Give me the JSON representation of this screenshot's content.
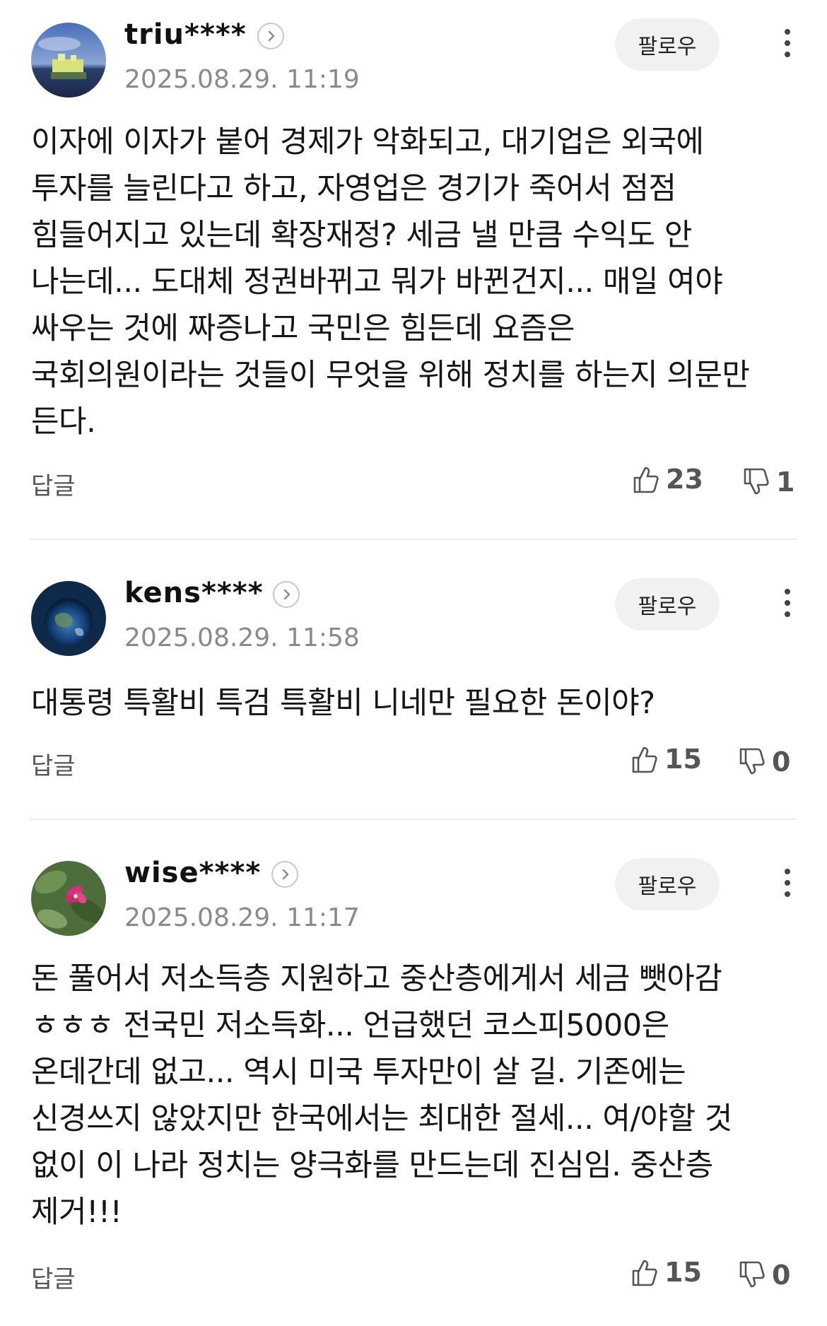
{
  "comments": [
    {
      "username": "triu****",
      "timestamp": "2025.08.29. 11:19",
      "follow_label": "팔로우",
      "text": "이자에 이자가 붙어 경제가 악화되고, 대기업은 외국에 투자를 늘린다고 하고, 자영업은 경기가 죽어서 점점 힘들어지고 있는데 확장재정? 세금 낼 만큼 수익도 안 나는데... 도대체 정권바뀌고 뭐가 바뀐건지... 매일 여야 싸우는 것에 짜증나고 국민은 힘든데 요즘은 국회의원이라는 것들이 무엇을 위해 정치를 하는지 의문만 든다.",
      "reply_label": "답글",
      "likes": "23",
      "dislikes": "1"
    },
    {
      "username": "kens****",
      "timestamp": "2025.08.29. 11:58",
      "follow_label": "팔로우",
      "text": "대통령 특활비 특검 특활비 니네만 필요한 돈이야?",
      "reply_label": "답글",
      "likes": "15",
      "dislikes": "0"
    },
    {
      "username": "wise****",
      "timestamp": "2025.08.29. 11:17",
      "follow_label": "팔로우",
      "text": "돈 풀어서 저소득층 지원하고 중산층에게서 세금 뺏아감 ㅎㅎㅎ 전국민 저소득화... 언급했던 코스피5000은 온데간데 없고... 역시 미국 투자만이 살 길. 기존에는 신경쓰지 않았지만 한국에서는 최대한 절세... 여/야할 것 없이 이 나라 정치는 양극화를 만드는데 진심임. 중산층 제거!!!",
      "reply_label": "답글",
      "likes": "15",
      "dislikes": "0"
    }
  ],
  "icons": {
    "profile": "chevron-right-icon",
    "more": "more-vertical-icon",
    "like": "thumbs-up-icon",
    "dislike": "thumbs-down-icon"
  },
  "colors": {
    "follow_bg": "#f1f1f1",
    "timestamp": "#8a8a8a",
    "divider": "#ececec"
  }
}
